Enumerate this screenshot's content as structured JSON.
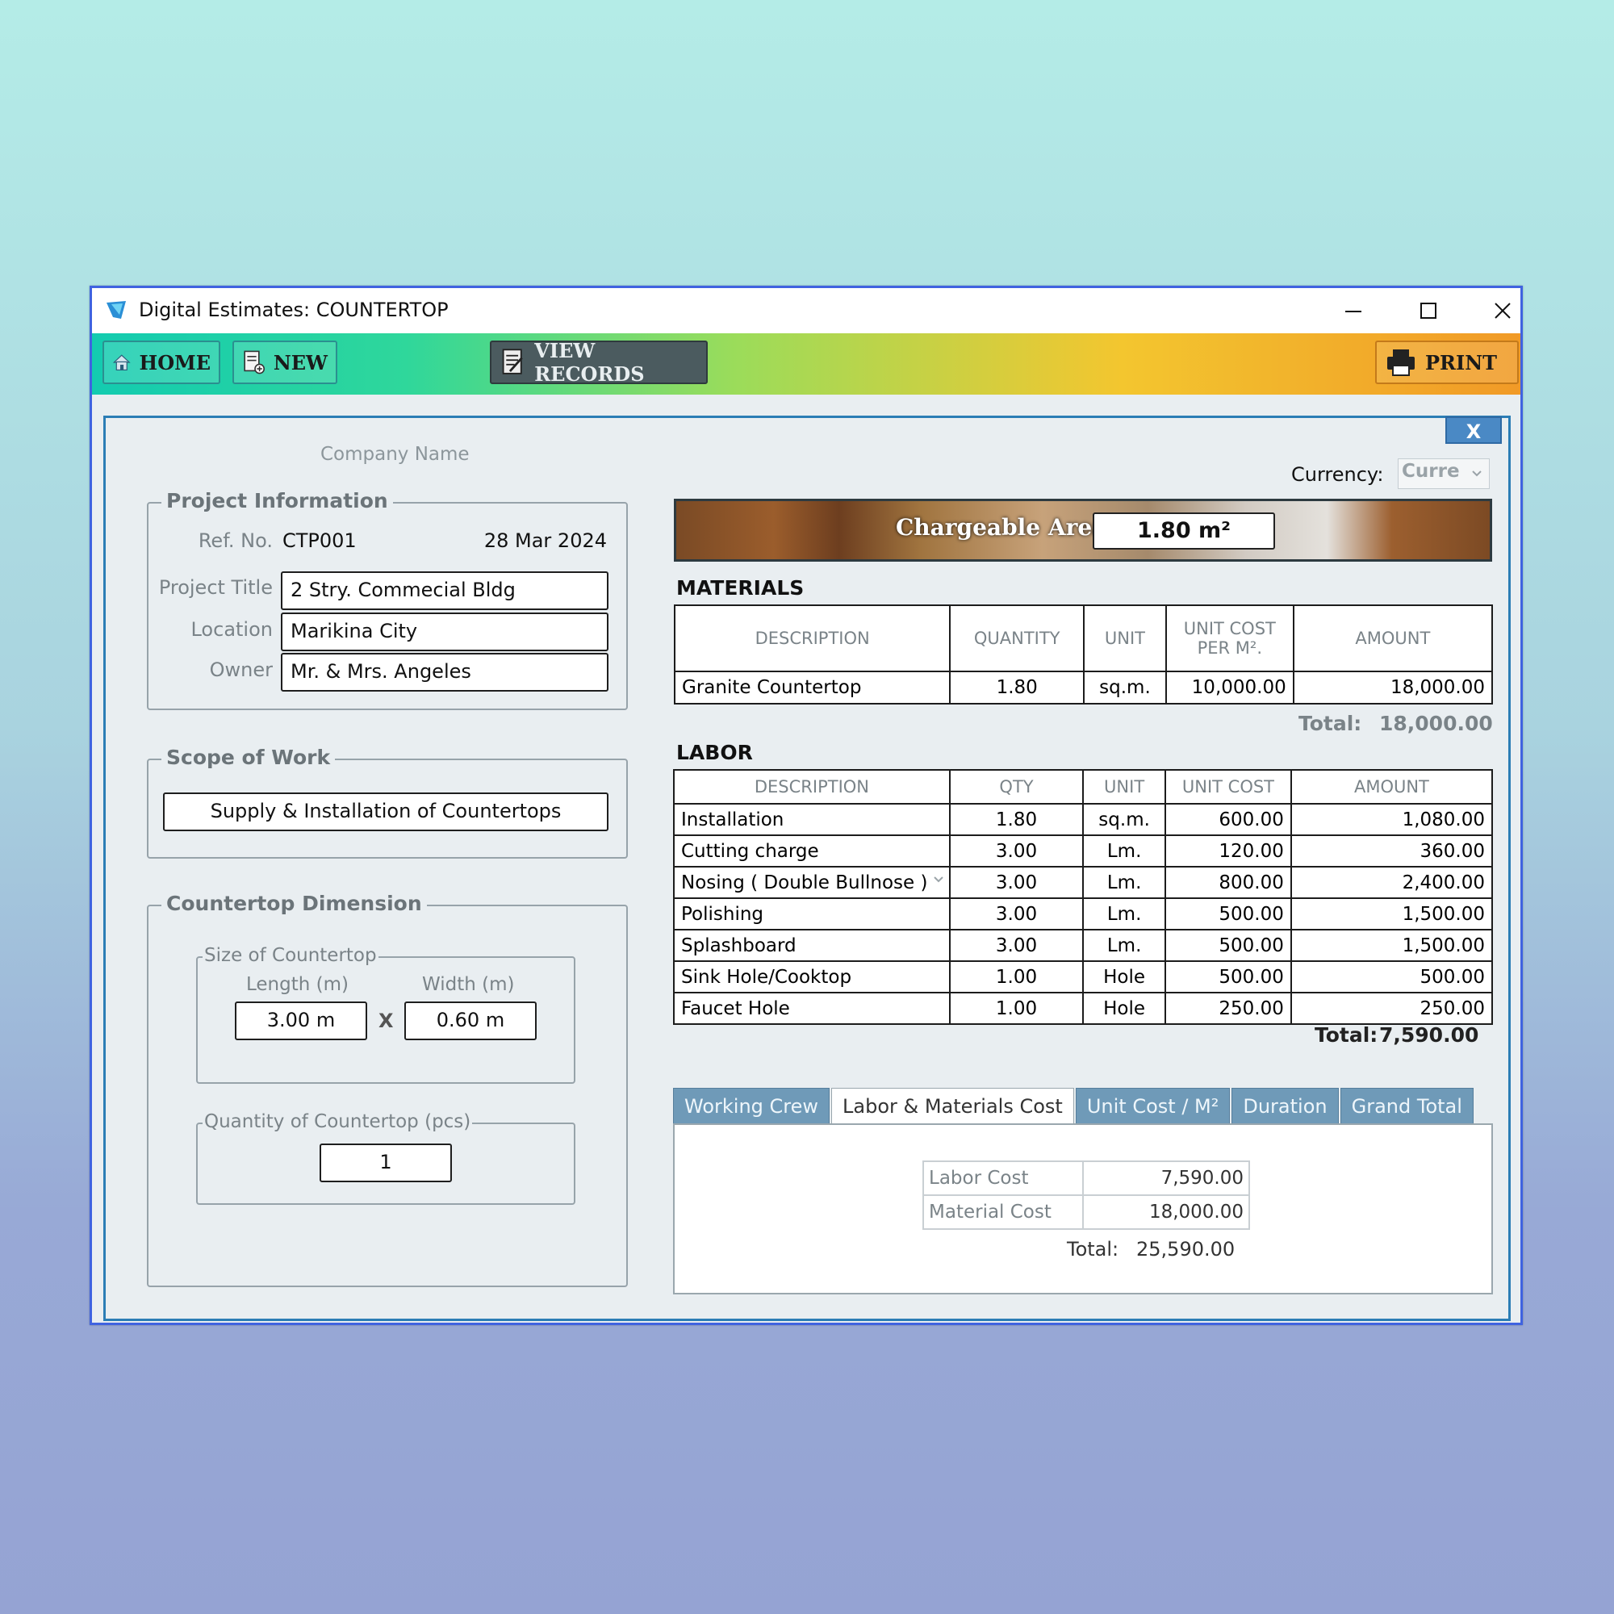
{
  "window": {
    "title": "Digital Estimates: COUNTERTOP",
    "minimize_label": "—",
    "maximize_label": "☐",
    "close_label": "✕"
  },
  "toolbar": {
    "home_label": "HOME",
    "new_label": "NEW",
    "view_records_label": "VIEW RECORDS",
    "print_label": "PRINT",
    "accent_start": "#13cbb0",
    "accent_end": "#f19a27"
  },
  "panel": {
    "close_label": "X",
    "company_name": "Company Name",
    "currency_label": "Currency:",
    "currency_value": "Curre"
  },
  "project_info": {
    "legend": "Project Information",
    "ref_label": "Ref. No.",
    "ref_value": "CTP001",
    "date": "28 Mar 2024",
    "title_label": "Project Title",
    "title_value": "2 Stry. Commecial Bldg",
    "location_label": "Location",
    "location_value": "Marikina City",
    "owner_label": "Owner",
    "owner_value": "Mr. & Mrs. Angeles"
  },
  "scope": {
    "legend": "Scope of Work",
    "value": "Supply & Installation of Countertops"
  },
  "dimension": {
    "legend": "Countertop Dimension",
    "size_legend": "Size of Countertop",
    "length_label": "Length (m)",
    "width_label": "Width (m)",
    "length_value": "3.00 m",
    "width_value": "0.60 m",
    "times": "X",
    "qty_legend": "Quantity of Countertop (pcs)",
    "qty_value": "1"
  },
  "chargeable": {
    "label": "Chargeable Area",
    "value": "1.80 m²"
  },
  "materials": {
    "title": "MATERIALS",
    "headers": [
      "DESCRIPTION",
      "QUANTITY",
      "UNIT",
      "UNIT COST PER M².",
      "AMOUNT"
    ],
    "rows": [
      [
        "Granite Countertop",
        "1.80",
        "sq.m.",
        "10,000.00",
        "18,000.00"
      ]
    ],
    "total_label": "Total:",
    "total_value": "18,000.00"
  },
  "labor": {
    "title": "LABOR",
    "headers": [
      "DESCRIPTION",
      "QTY",
      "UNIT",
      "UNIT COST",
      "AMOUNT"
    ],
    "rows": [
      [
        "Installation",
        "1.80",
        "sq.m.",
        "600.00",
        "1,080.00"
      ],
      [
        "Cutting charge",
        "3.00",
        "Lm.",
        "120.00",
        "360.00"
      ],
      [
        "Nosing ( Double Bullnose )",
        "3.00",
        "Lm.",
        "800.00",
        "2,400.00"
      ],
      [
        "Polishing",
        "3.00",
        "Lm.",
        "500.00",
        "1,500.00"
      ],
      [
        "Splashboard",
        "3.00",
        "Lm.",
        "500.00",
        "1,500.00"
      ],
      [
        "Sink Hole/Cooktop",
        "1.00",
        "Hole",
        "500.00",
        "500.00"
      ],
      [
        "Faucet Hole",
        "1.00",
        "Hole",
        "250.00",
        "250.00"
      ]
    ],
    "total_label": "Total:",
    "total_value": "7,590.00"
  },
  "tabs": {
    "items": [
      "Working Crew",
      "Labor & Materials Cost",
      "Unit Cost / M²",
      "Duration",
      "Grand Total"
    ],
    "active": "Labor & Materials Cost"
  },
  "summary": {
    "labor_label": "Labor Cost",
    "labor_value": "7,590.00",
    "material_label": "Material Cost",
    "material_value": "18,000.00",
    "total_label": "Total:",
    "total_value": "25,590.00"
  }
}
